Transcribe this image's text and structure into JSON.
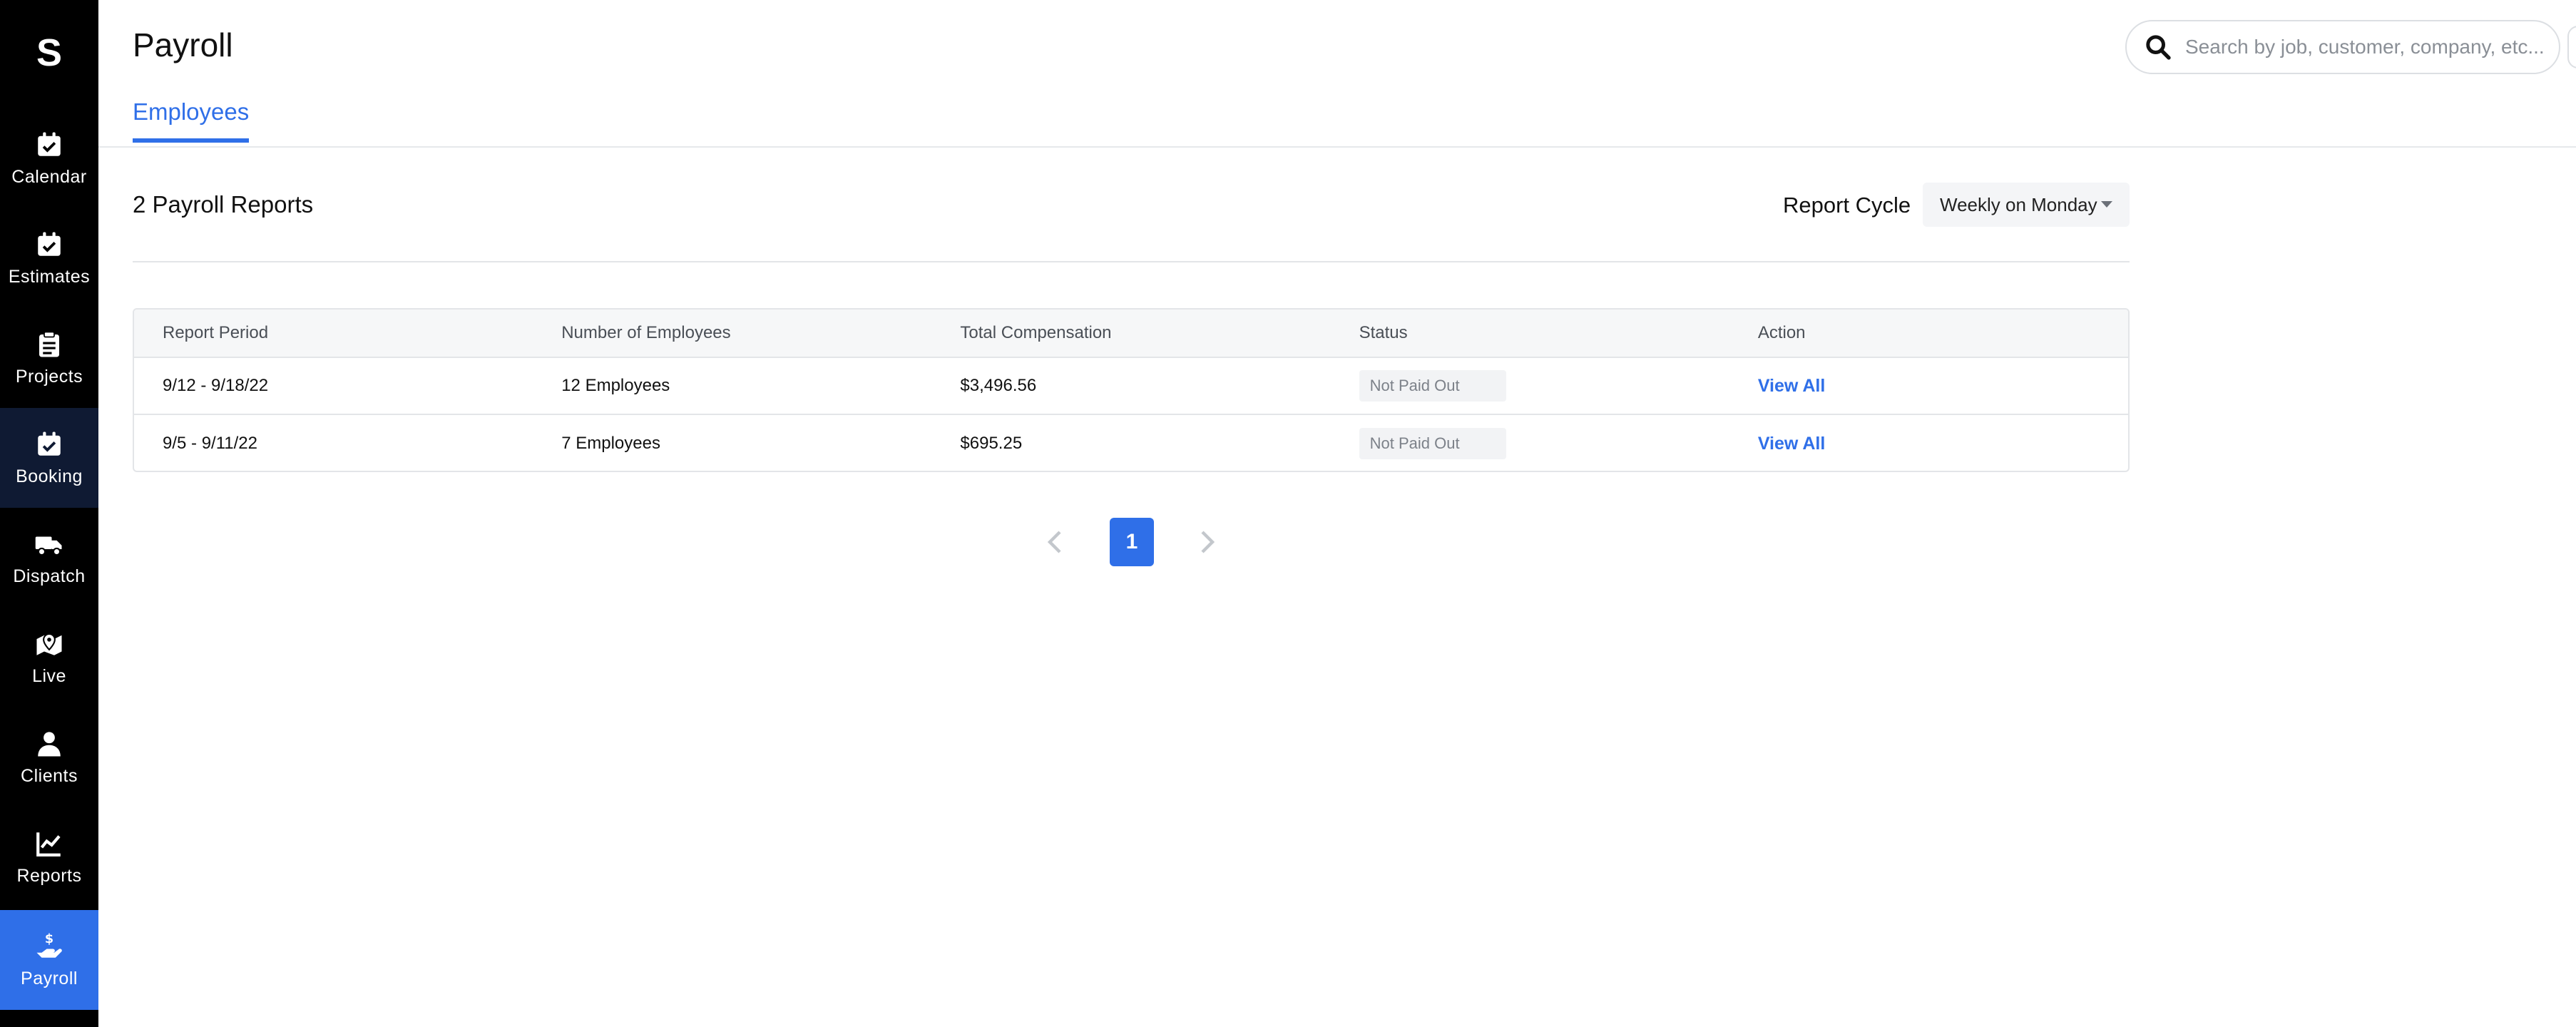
{
  "app": {
    "logo_letter": "S"
  },
  "sidebar": {
    "items": [
      {
        "label": "Calendar",
        "icon": "calendar-check-icon"
      },
      {
        "label": "Estimates",
        "icon": "calendar-check-icon"
      },
      {
        "label": "Projects",
        "icon": "clipboard-icon"
      },
      {
        "label": "Booking",
        "icon": "calendar-check-icon",
        "state": "hover"
      },
      {
        "label": "Dispatch",
        "icon": "truck-icon"
      },
      {
        "label": "Live",
        "icon": "map-pin-icon"
      },
      {
        "label": "Clients",
        "icon": "user-icon"
      },
      {
        "label": "Reports",
        "icon": "line-chart-icon"
      },
      {
        "label": "Payroll",
        "icon": "hand-dollar-icon",
        "state": "active"
      }
    ],
    "colors": {
      "background": "#000000",
      "hover": "#0f1a33",
      "active": "#2f6fe8"
    }
  },
  "header": {
    "title": "Payroll",
    "tabs": [
      {
        "label": "Employees",
        "active": true
      }
    ],
    "search": {
      "placeholder": "Search by job, customer, company, etc...",
      "value": ""
    }
  },
  "main": {
    "reports_count": "2 Payroll Reports",
    "report_cycle": {
      "label": "Report Cycle",
      "selected": "Weekly on Monday"
    },
    "table": {
      "columns": [
        "Report Period",
        "Number of Employees",
        "Total Compensation",
        "Status",
        "Action"
      ],
      "rows": [
        {
          "period": "9/12 - 9/18/22",
          "employees": "12 Employees",
          "compensation": "$3,496.56",
          "status": "Not Paid Out",
          "action": "View All"
        },
        {
          "period": "9/5 - 9/11/22",
          "employees": "7 Employees",
          "compensation": "$695.25",
          "status": "Not Paid Out",
          "action": "View All"
        }
      ]
    },
    "pagination": {
      "current_page": "1"
    }
  },
  "colors": {
    "accent": "#2f6fe8",
    "status_badge_bg": "#f2f3f5"
  }
}
